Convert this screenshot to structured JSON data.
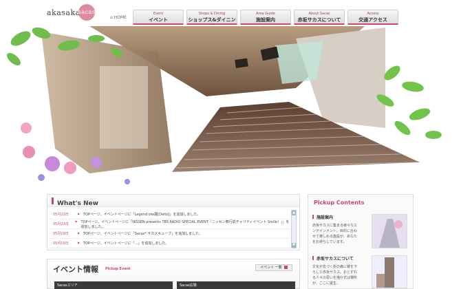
{
  "header": {
    "logo_text": "akasaka",
    "logo_badge": "sacas",
    "home_label": "HOME",
    "nav": [
      {
        "en": "Event",
        "jp": "イベント"
      },
      {
        "en": "Shops & Dining",
        "jp": "ショップス&ダイニング"
      },
      {
        "en": "Area Guide",
        "jp": "施設案内"
      },
      {
        "en": "About Sacas",
        "jp": "赤坂サカスについて"
      },
      {
        "en": "Access",
        "jp": "交通アクセス"
      }
    ]
  },
  "news": {
    "title": "What's New",
    "items": [
      {
        "date": "05月23日",
        "text": "TOPページ、イベントページに「Legend olw展[Deito]」を追加しました。"
      },
      {
        "date": "05月23日",
        "text": "TOPページ、イベントページに「NISSEN presents TBS RADIO SPECIAL EVENT『ニッセン祭行前チャリティイベント Smile！』」を追加しました。"
      },
      {
        "date": "05月19日",
        "text": "TOPページ、イベントページに「Sacas* サカスキューブ」を追加しました。"
      },
      {
        "date": "05月19日",
        "text": "TOPページ、イベントページに「...」を追加しました。"
      }
    ]
  },
  "events": {
    "title": "イベント情報",
    "subtitle": "Pickup Event",
    "more_label": "イベント 一覧",
    "tiles": [
      "Sacasエリア",
      "Sacas広場"
    ]
  },
  "pickup": {
    "title": "Pickup Contents",
    "sections": [
      {
        "head": "施設案内",
        "desc": "赤坂サカスに集まる様々なエンテインメント。目的に合わせて楽しめる施設が、あなたをお待ちしています。"
      },
      {
        "head": "赤坂サカスについて",
        "desc": "文化が息づく街の森に躍を下ろした赤坂サカス。おとずれる人々の思いを描かずば場所が、ここに誕生。"
      }
    ]
  },
  "colors": {
    "accent": "#c9476a"
  }
}
